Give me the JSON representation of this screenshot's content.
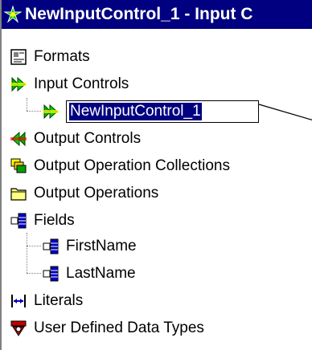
{
  "window": {
    "title": "NewInputControl_1 - Input C"
  },
  "tree": {
    "items": [
      {
        "label": "Formats",
        "icon": "formats-icon"
      },
      {
        "label": "Input Controls",
        "icon": "input-controls-icon"
      },
      {
        "label": "NewInputControl_1",
        "icon": "input-control-icon",
        "editing": true
      },
      {
        "label": "Output Controls",
        "icon": "output-controls-icon"
      },
      {
        "label": "Output Operation Collections",
        "icon": "collections-icon"
      },
      {
        "label": "Output Operations",
        "icon": "folder-icon"
      },
      {
        "label": "Fields",
        "icon": "fields-icon"
      },
      {
        "label": "FirstName",
        "icon": "field-icon"
      },
      {
        "label": "LastName",
        "icon": "field-icon"
      },
      {
        "label": "Literals",
        "icon": "literals-icon"
      },
      {
        "label": "User Defined Data Types",
        "icon": "udt-icon"
      }
    ]
  },
  "colors": {
    "titlebar": "#000080",
    "selection": "#000080",
    "connector": "#808080"
  }
}
